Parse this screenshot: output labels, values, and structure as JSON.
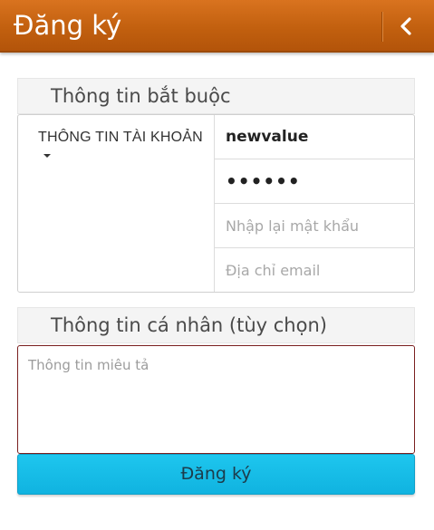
{
  "header": {
    "title": "Đăng ký",
    "back_icon": "chevron-left-icon"
  },
  "required_section": {
    "title": "Thông tin bắt buộc",
    "account_label": "THÔNG TIN TÀI KHOẢN",
    "username_value": "newvalue",
    "password_value": "••••••",
    "confirm_password_placeholder": "Nhập lại mật khẩu",
    "email_placeholder": "Địa chỉ email"
  },
  "personal_section": {
    "title": "Thông tin cá nhân (tùy chọn)",
    "description_placeholder": "Thông tin miêu tả"
  },
  "submit": {
    "label": "Đăng ký"
  },
  "colors": {
    "header": "#c2600f",
    "button": "#10b3e0",
    "textarea_border": "#7a1f1f"
  }
}
